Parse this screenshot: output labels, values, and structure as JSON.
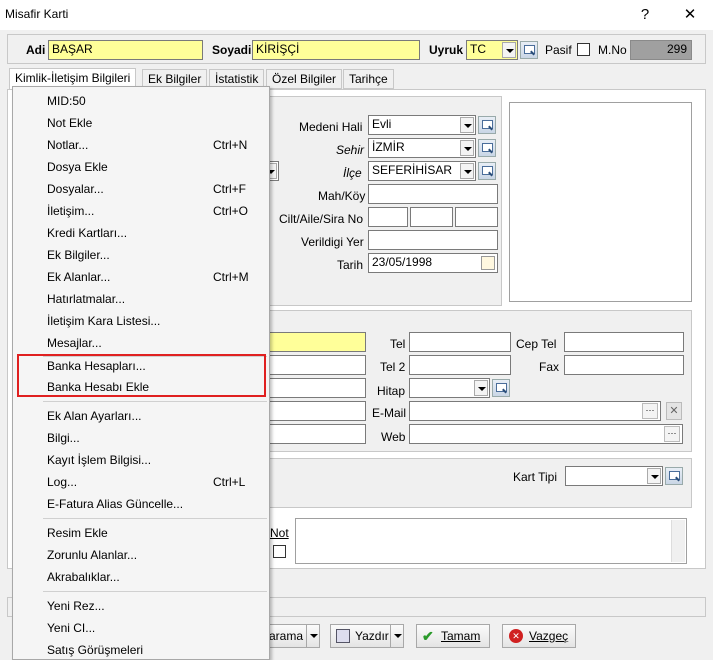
{
  "window": {
    "title": "Misafir Karti",
    "help": "?",
    "close": "✕"
  },
  "header": {
    "adi_label": "Adi",
    "adi_value": "BAŞAR",
    "soyadi_label": "Soyadi",
    "soyadi_value": "KİRİŞÇİ",
    "uyruk_label": "Uyruk",
    "uyruk_value": "TC",
    "pasif_label": "Pasif",
    "mno_label": "M.No",
    "mno_value": "299"
  },
  "tabs": [
    "Kimlik-İletişim Bilgileri",
    "Ek Bilgiler",
    "İstatistik",
    "Özel Bilgiler",
    "Tarihçe"
  ],
  "form": {
    "medeni_hali_label": "Medeni Hali",
    "medeni_hali_value": "Evli",
    "sehir_label": "Sehir",
    "sehir_value": "İZMİR",
    "ilce_label": "İlçe",
    "ilce_value": "SEFERİHİSAR",
    "mah_label": "Mah/Köy",
    "cilt_label": "Cilt/Aile/Sira No",
    "verildigi_label": "Verildigi Yer",
    "tarih_label": "Tarih",
    "tarih_value": "23/05/1998",
    "tel_label": "Tel",
    "cep_tel_label": "Cep Tel",
    "tel2_label": "Tel 2",
    "fax_label": "Fax",
    "hitap_label": "Hitap",
    "email_label": "E-Mail",
    "web_label": "Web",
    "kart_tipi_label": "Kart Tipi",
    "not_label": "Not"
  },
  "context_menu": {
    "items": [
      {
        "label": "MID:50",
        "shortcut": ""
      },
      {
        "label": "Not Ekle",
        "shortcut": ""
      },
      {
        "label": "Notlar...",
        "shortcut": "Ctrl+N"
      },
      {
        "label": "Dosya Ekle",
        "shortcut": ""
      },
      {
        "label": "Dosyalar...",
        "shortcut": "Ctrl+F"
      },
      {
        "label": "İletişim...",
        "shortcut": "Ctrl+O"
      },
      {
        "label": "Kredi Kartları...",
        "shortcut": ""
      },
      {
        "label": "Ek Bilgiler...",
        "shortcut": ""
      },
      {
        "label": "Ek Alanlar...",
        "shortcut": "Ctrl+M"
      },
      {
        "label": "Hatırlatmalar...",
        "shortcut": ""
      },
      {
        "label": "İletişim Kara Listesi...",
        "shortcut": ""
      },
      {
        "label": "Mesajlar...",
        "shortcut": ""
      },
      {
        "label": "Banka Hesapları...",
        "shortcut": ""
      },
      {
        "label": "Banka Hesabı Ekle",
        "shortcut": ""
      },
      {
        "label": "Ek Alan Ayarları...",
        "shortcut": ""
      },
      {
        "label": "Bilgi...",
        "shortcut": ""
      },
      {
        "label": "Kayıt İşlem Bilgisi...",
        "shortcut": ""
      },
      {
        "label": "Log...",
        "shortcut": "Ctrl+L"
      },
      {
        "label": "E-Fatura Alias Güncelle...",
        "shortcut": ""
      },
      {
        "label": "Resim Ekle",
        "shortcut": ""
      },
      {
        "label": "Zorunlu Alanlar...",
        "shortcut": ""
      },
      {
        "label": "Akrabalıklar...",
        "shortcut": ""
      },
      {
        "label": "Yeni Rez...",
        "shortcut": ""
      },
      {
        "label": "Yeni CI...",
        "shortcut": ""
      },
      {
        "label": "Satış Görüşmeleri",
        "shortcut": ""
      }
    ]
  },
  "footer": {
    "arama": "arama",
    "yazdir": "Yazdır",
    "tamam": "Tamam",
    "vazgec": "Vazgeç"
  },
  "colors": {
    "highlight_box": "#e02020",
    "required_field": "#ffff99"
  }
}
